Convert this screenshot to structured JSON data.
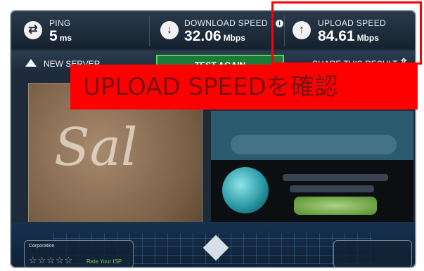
{
  "metrics": {
    "ping": {
      "label": "PING",
      "value": "5",
      "unit": "ms",
      "icon": "exchange-arrows-icon"
    },
    "download": {
      "label": "DOWNLOAD SPEED",
      "value": "32.06",
      "unit": "Mbps",
      "icon": "download-arrow-icon"
    },
    "upload": {
      "label": "UPLOAD SPEED",
      "value": "84.61",
      "unit": "Mbps",
      "icon": "upload-arrow-icon"
    }
  },
  "actions": {
    "new_server_label": "NEW SERVER",
    "test_again_label": "TEST AGAIN",
    "share_label": "SHARE THIS RESULT"
  },
  "isp": {
    "corporation_label": "Corporation",
    "stars": "☆☆☆☆☆",
    "rate_label": "Rate Your ISP"
  },
  "annotation": {
    "text": "UPLOAD SPEEDを確認",
    "color": "#ff0000"
  },
  "colors": {
    "frame_bg": "#1e2a38",
    "test_again_border": "#59d25a",
    "highlight": "#ff0000"
  }
}
